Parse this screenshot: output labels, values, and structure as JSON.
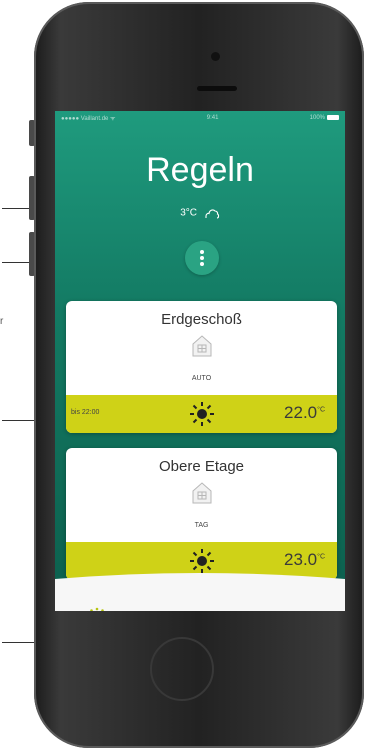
{
  "app": {
    "status_bar": {
      "carrier": "●●●●● Vaillant.de ᯤ",
      "time": "9:41",
      "battery": "100%"
    },
    "title": "Regeln",
    "outside_weather": {
      "value": "3°C"
    }
  },
  "annotations": {
    "side_note": "r"
  },
  "zones": [
    {
      "name": "Erdgeschoß",
      "mode": "AUTO",
      "until": "bis 22:00",
      "temperature": "22.0",
      "unit": "°C"
    },
    {
      "name": "Obere Etage",
      "mode": "TAG",
      "until": "",
      "temperature": "23.0",
      "unit": "°C"
    }
  ],
  "tabbar": {
    "tabs": [
      {
        "icon": "thermostat-icon"
      },
      {
        "icon": "energy-leaf-icon"
      },
      {
        "icon": "settings-gear-icon"
      }
    ]
  },
  "colors": {
    "accent_green": "#137a63",
    "accent_yellow": "#cfd217",
    "button_green": "#2aa383"
  }
}
